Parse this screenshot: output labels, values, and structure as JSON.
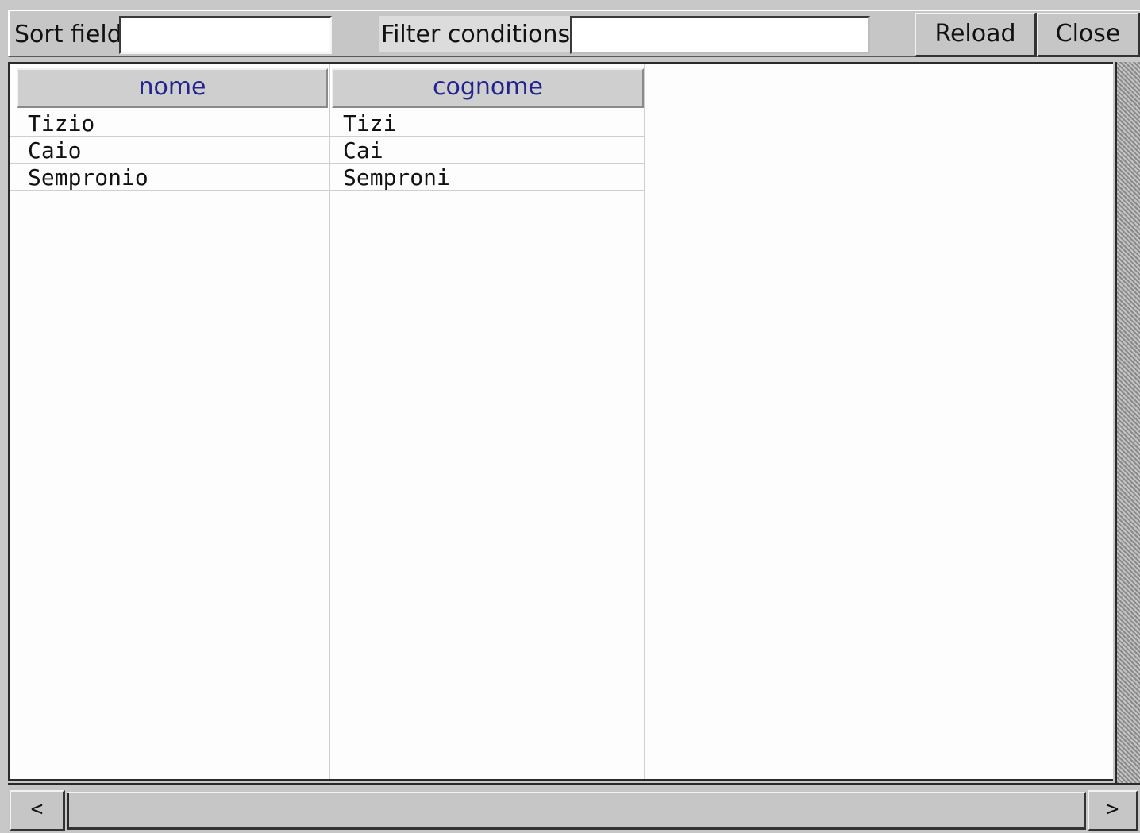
{
  "toolbar": {
    "sort_label": "Sort field",
    "sort_value": "",
    "filter_label": "Filter conditions",
    "filter_value": "",
    "reload_label": "Reload",
    "close_label": "Close"
  },
  "table": {
    "columns": [
      "nome",
      "cognome"
    ],
    "rows": [
      [
        "Tizio",
        "Tizi"
      ],
      [
        "Caio",
        "Cai"
      ],
      [
        "Sempronio",
        "Semproni"
      ]
    ]
  },
  "hscroll": {
    "left_arrow": "<",
    "right_arrow": ">"
  },
  "colors": {
    "header_text": "#23238e",
    "background": "#c8c8c8",
    "table_background": "#fdfdfd"
  }
}
